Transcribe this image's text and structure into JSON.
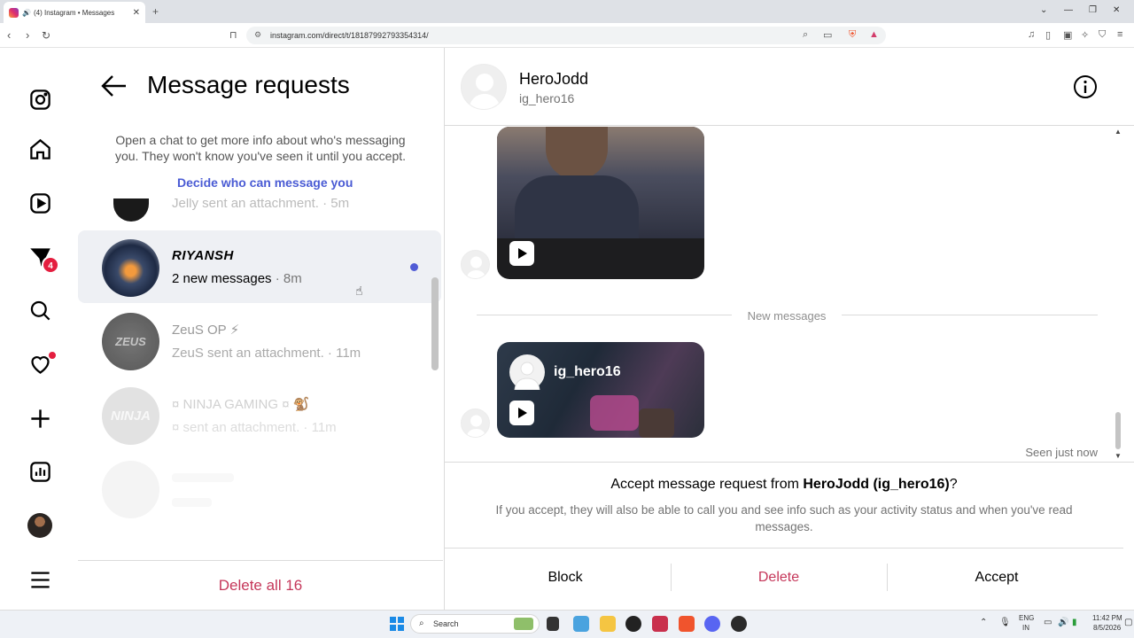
{
  "browser": {
    "tab_title": "(4) Instagram • Messages",
    "url": "instagram.com/direct/t/18187992793354314/"
  },
  "rail": {
    "notifications_badge": "4"
  },
  "requests_panel": {
    "title": "Message requests",
    "info_text": "Open a chat to get more info about who's messaging you. They won't know you've seen it until you accept.",
    "decide_link": "Decide who can message you",
    "partial_item_subtitle": "Jelly sent an attachment. · 5m",
    "items": [
      {
        "name": "RIYANSH",
        "subtitle": "2 new messages",
        "time": "· 8m"
      },
      {
        "name": "ZeuS OP ⚡",
        "subtitle": "ZeuS sent an attachment. · 11m",
        "avatar_text": "ZEUS"
      },
      {
        "name": "¤ NINJA GAMING ¤ 🐒",
        "subtitle": "¤ sent an attachment. · 11m",
        "avatar_text": "NINJA"
      }
    ],
    "delete_all": "Delete all 16"
  },
  "conversation": {
    "name": "HeroJodd",
    "username": "ig_hero16",
    "new_messages_label": "New messages",
    "shared_post_user": "ig_hero16",
    "seen_label": "Seen just now",
    "accept_prompt_prefix": "Accept message request from ",
    "accept_prompt_name": "HeroJodd (ig_hero16)",
    "accept_prompt_suffix": "?",
    "accept_description": "If you accept, they will also be able to call you and see info such as your activity status and when you've read messages.",
    "block_label": "Block",
    "delete_label": "Delete",
    "accept_label": "Accept"
  },
  "colors": {
    "accent_link": "#4a5bd4",
    "delete_red": "#c5375a",
    "badge_red": "#e41e3f",
    "unread_dot": "#4f5bd5"
  },
  "taskbar": {
    "search_placeholder": "Search",
    "lang_top": "ENG",
    "lang_bottom": "IN",
    "time": "11:42 PM",
    "date": "8/5/2026"
  }
}
